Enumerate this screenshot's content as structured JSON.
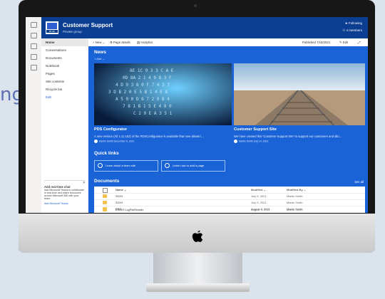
{
  "background_fragment": "ng",
  "site": {
    "title": "Customer Support",
    "subtitle": "Private group",
    "follow": "★ Following",
    "members": "⚇ 4 members"
  },
  "nav": [
    "Home",
    "Conversations",
    "Documents",
    "Notebook",
    "Pages",
    "Site contents",
    "Recycle bin",
    "Edit"
  ],
  "chat": {
    "title": "Add real-time chat",
    "body": "Add Microsoft Teams to collaborate in real-time and share resources across Microsoft 365 with your team.",
    "link": "Add Microsoft Teams"
  },
  "cmdbar": {
    "new": "+ New ⌄",
    "page_details": "⚙ Page details",
    "analytics": "▤ Analytics",
    "published": "Published 7/15/2021",
    "edit": "✎ Edit",
    "expand": "⤢"
  },
  "news": {
    "heading": "News",
    "add": "+ Add ⌄",
    "items": [
      {
        "title": "PDS Configurator",
        "desc": "A new version (All 1.11.162) of the PDSConfigurator is available that now allows t...",
        "author": "Martin Smith  December 5, 2021"
      },
      {
        "title": "Customer Support Site",
        "desc": "We have created this 'Customer Support Site' to support our customers and allo...",
        "author": "Martin Smith  July 14, 2021"
      }
    ]
  },
  "quick_links": {
    "heading": "Quick links",
    "items": [
      "Learn about a team site",
      "Learn how to add a page"
    ]
  },
  "documents": {
    "heading": "Documents",
    "see_all": "See all",
    "columns": [
      "Name ⌄",
      "Modified ⌄",
      "Modified By ⌄"
    ],
    "rows": [
      {
        "name": "SGHI",
        "modified": "July 9, 2021",
        "by": "Martin Smith"
      },
      {
        "name": "SGHI",
        "modified": "July 9, 2021",
        "by": "Martin Smith"
      },
      {
        "name": "EPG",
        "modified": "August 8, 2021",
        "by": "Martin Smith"
      },
      {
        "name": "EWDS LogFileReader",
        "modified": "August 9, 2021",
        "by": "Martin Smith"
      }
    ]
  },
  "colors": {
    "header": "#0b3d91",
    "content": "#1a63d6",
    "accent": "#2060c8"
  }
}
